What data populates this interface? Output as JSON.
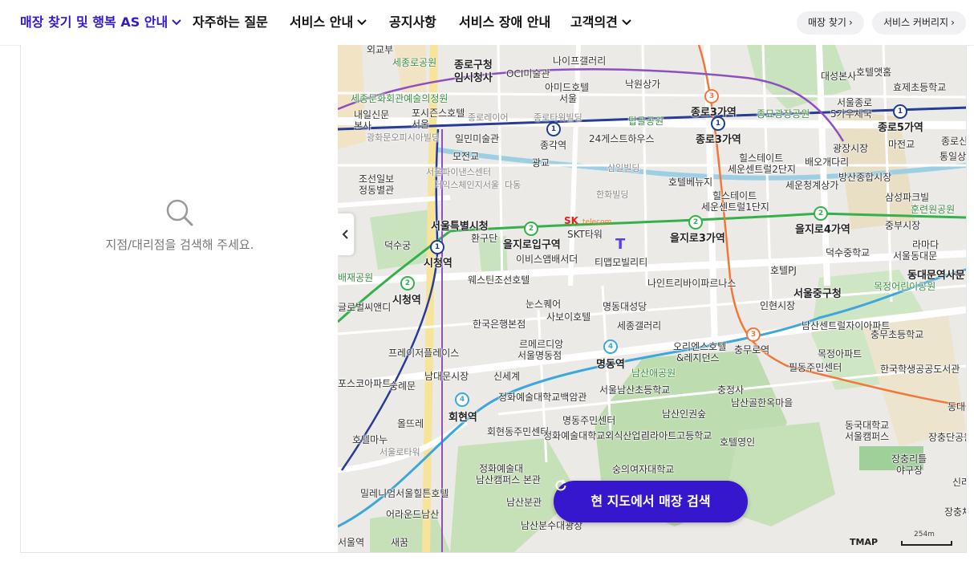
{
  "nav": {
    "items": [
      {
        "label": "매장 찾기 및 행복 AS 안내",
        "active": true,
        "has_dropdown": true
      },
      {
        "label": "자주하는 질문",
        "active": false,
        "has_dropdown": false
      },
      {
        "label": "서비스 안내",
        "active": false,
        "has_dropdown": true
      },
      {
        "label": "공지사항",
        "active": false,
        "has_dropdown": false
      },
      {
        "label": "서비스 장애 안내",
        "active": false,
        "has_dropdown": false
      },
      {
        "label": "고객의견",
        "active": false,
        "has_dropdown": true
      }
    ],
    "chips": [
      {
        "label": "매장 찾기"
      },
      {
        "label": "서비스 커버리지"
      }
    ],
    "chip_arrow": "›",
    "colors": {
      "active": "#3617ce",
      "chip_bg": "#f1f1f3"
    }
  },
  "left_panel": {
    "empty_icon": "search-icon",
    "empty_message": "지점/대리점을 검색해 주세요."
  },
  "map": {
    "collapse_icon": "chevron-left-icon",
    "search_button_label": "현 지도에서 매장 검색",
    "search_button_icon": "refresh-icon",
    "provider": "TMAP",
    "scale_label": "254m",
    "sk_logo": {
      "brand": "SK",
      "sub": "telecom"
    },
    "labels": [
      "외교부",
      "세종로공원",
      "종로구청",
      "임시청사",
      "나이프갤러리",
      "OCI미술관",
      "아미드호텔",
      "서울",
      "낙원상가",
      "세종문화회관예술의정원",
      "포시즌스호텔",
      "서울",
      "종로레이어",
      "탑골공원",
      "종로3가역",
      "종묘광장공원",
      "서울종로",
      "5가우체국",
      "종로5가역",
      "호텔앳홈",
      "효제초등학교",
      "대성본사",
      "내일신문",
      "본사",
      "광화문오피시아빌딩",
      "일민미술관",
      "종로타워빌딩",
      "종각역",
      "24게스트하우스",
      "종로3가역",
      "광장시장",
      "마전교",
      "종로신진",
      "통일상가",
      "조선일보",
      "정동별관",
      "서울파이낸스센터",
      "더익스체인지서울",
      "다동",
      "모전교",
      "광교",
      "삼일빌딩",
      "호텔베뉴지",
      "힐스테이트",
      "세운센트럴2단지",
      "배오개다리",
      "방산종합시장",
      "세운청계상가",
      "덕수궁",
      "서울특별시청",
      "환구단",
      "을지로입구역",
      "SKT타워",
      "한화빌딩",
      "힐스테이트",
      "세운센트럴1단지",
      "을지로3가역",
      "삼성파크빌",
      "훈련원공원",
      "중부시장",
      "을지로4가역",
      "라마다",
      "서울동대문",
      "시청역",
      "이비스앰배서더",
      "티맵모빌리티",
      "나인트리바이파르나스",
      "호텔PJ",
      "덕수중학교",
      "서울중구청",
      "목정어린이공원",
      "동대문역사문",
      "시청역",
      "웨스틴조선호텔",
      "눈스퀘어",
      "명동대성당",
      "인현시장",
      "배재공원",
      "글로벌씨앤디",
      "한국은행본점",
      "사보이호텔",
      "세종갤러리",
      "남산센트럴자이아파트",
      "충무초등학교",
      "르메르디앙",
      "서울명동점",
      "오리엔스호텔",
      "&레지던스",
      "충무로역",
      "목정아파트",
      "프레이저플레이스",
      "명동역",
      "남대문시장",
      "신세계",
      "남산애공원",
      "필동주민센터",
      "한국학생공공도서관",
      "포스코아파트",
      "숭례문",
      "서울남산초등학교",
      "충정사",
      "남산골한옥마을",
      "정화예술대학교백암관",
      "회현역",
      "올뜨레",
      "명동주민센터",
      "남산인권숲",
      "동국대학교",
      "서울캠퍼스",
      "장충단공원",
      "회현동주민센터",
      "정화예술대학교외식산업관",
      "리라아트고등학교",
      "호텔마누",
      "서울로타워",
      "호텔영인",
      "장충리틀",
      "야구장",
      "정화예술대",
      "남산캠퍼스 본관",
      "숭의여자대학교",
      "밀레니엄서울힐튼호텔",
      "남산분관",
      "신라호텔",
      "어라운드남산",
      "남산분수대광장",
      "서울역",
      "새꿈",
      "동대입구",
      "장충체육관"
    ]
  }
}
